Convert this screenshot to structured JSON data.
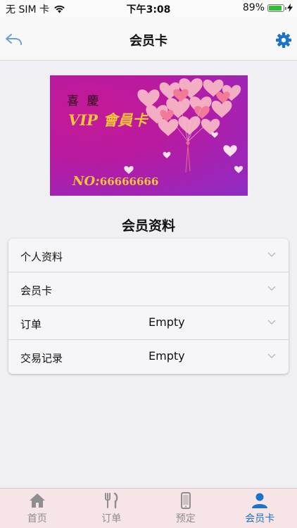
{
  "status_bar": {
    "carrier": "无 SIM 卡",
    "time": "下午3:08",
    "battery": "89%",
    "battery_level": 0.89
  },
  "nav": {
    "title": "会员卡",
    "back_icon": "undo-arrow-icon",
    "settings_icon": "gear-icon",
    "accent": "#1a73c9"
  },
  "card": {
    "greeting": "喜 慶",
    "vip_title": "VIP 會員卡",
    "number_prefix": "NO:",
    "number": "66666666"
  },
  "section": {
    "title": "会员资料"
  },
  "rows": [
    {
      "label": "个人资料",
      "value": ""
    },
    {
      "label": "会员卡",
      "value": ""
    },
    {
      "label": "订单",
      "value": "Empty"
    },
    {
      "label": "交易记录",
      "value": "Empty"
    }
  ],
  "tabs": [
    {
      "label": "首页",
      "icon": "home-icon",
      "active": false
    },
    {
      "label": "订单",
      "icon": "fork-knife-icon",
      "active": false
    },
    {
      "label": "预定",
      "icon": "phone-icon",
      "active": false
    },
    {
      "label": "会员卡",
      "icon": "user-icon",
      "active": true
    }
  ]
}
